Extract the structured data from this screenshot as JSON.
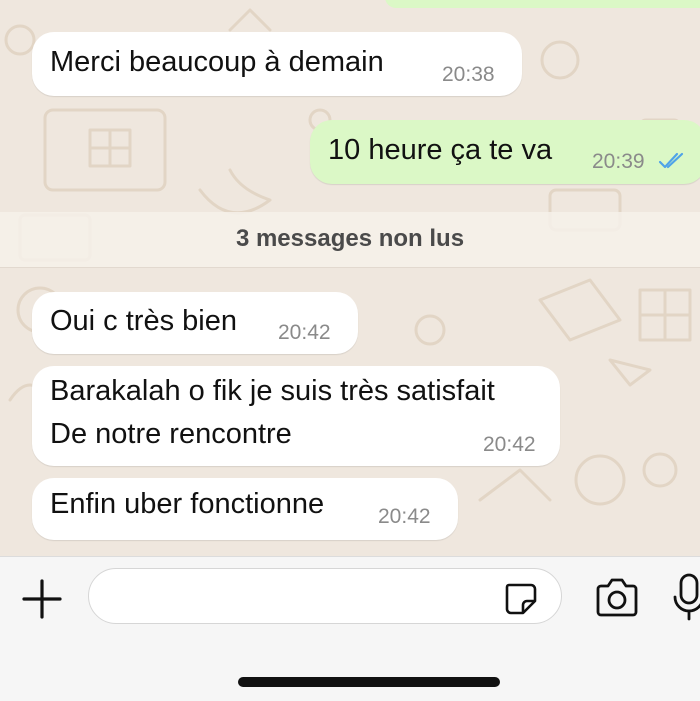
{
  "chat": {
    "messages": [
      {
        "direction": "incoming",
        "text": "Merci beaucoup à demain",
        "time": "20:38"
      },
      {
        "direction": "outgoing",
        "text": "10 heure ça te va",
        "time": "20:39",
        "status": "read"
      },
      {
        "direction": "incoming",
        "text": "Oui c très bien",
        "time": "20:42"
      },
      {
        "direction": "incoming",
        "lines": [
          "Barakalah o fik je suis très satisfait",
          "De notre rencontre"
        ],
        "time": "20:42"
      },
      {
        "direction": "incoming",
        "text": "Enfin uber fonctionne",
        "time": "20:42"
      }
    ],
    "unread_divider": "3 messages non lus"
  },
  "composer": {
    "input_value": "",
    "icons": {
      "attach": "plus-icon",
      "sticker": "sticker-icon",
      "camera": "camera-icon",
      "voice": "microphone-icon"
    }
  },
  "colors": {
    "wallpaper": "#efe7de",
    "incoming_bubble": "#ffffff",
    "outgoing_bubble": "#dbf8c6",
    "read_receipt": "#4fa3e8",
    "timestamp": "#8a8a8a"
  }
}
